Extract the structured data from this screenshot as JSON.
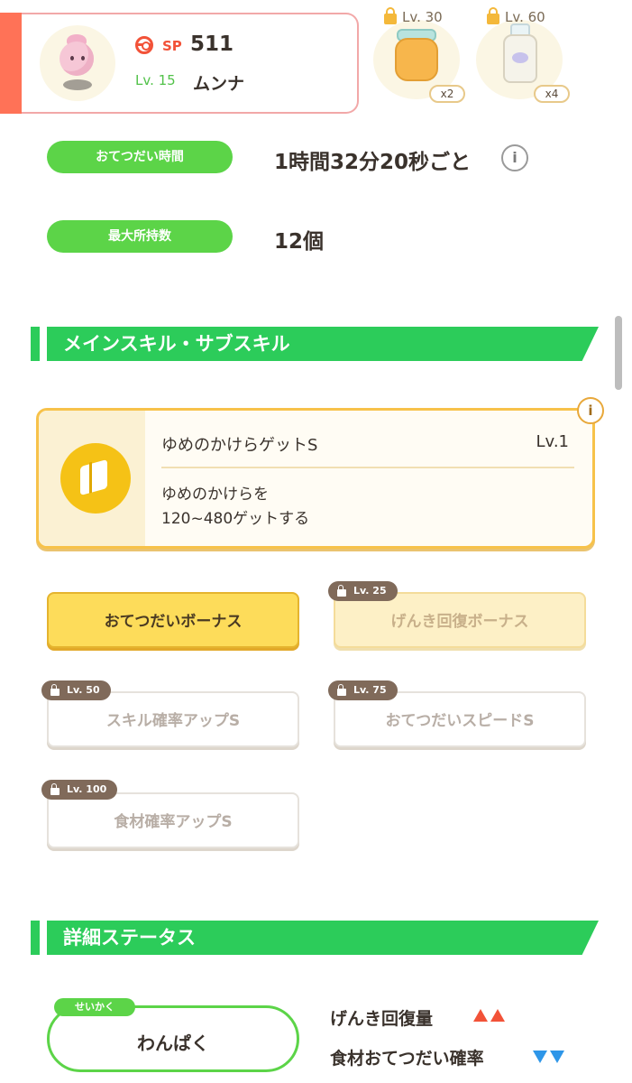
{
  "header": {
    "sp_label": "SP",
    "sp_value": "511",
    "level": "Lv. 15",
    "pokemon_name": "ムンナ",
    "items": [
      {
        "unlock_level": "Lv. 30",
        "count": "x2",
        "icon": "honey-jar-icon"
      },
      {
        "unlock_level": "Lv. 60",
        "count": "x4",
        "icon": "milk-bottle-icon"
      }
    ]
  },
  "stats": {
    "help_time_label": "おてつだい時間",
    "help_time_value": "1時間32分20秒ごと",
    "max_carry_label": "最大所持数",
    "max_carry_value": "12個"
  },
  "skills_section": {
    "title": "メインスキル・サブスキル",
    "main_skill": {
      "name": "ゆめのかけらゲットS",
      "level": "Lv.1",
      "desc_line1": "ゆめのかけらを",
      "desc_line2": "120~480ゲットする",
      "icon": "dream-shard-icon"
    },
    "sub_skills": [
      {
        "label": "おてつだいボーナス",
        "unlock": ""
      },
      {
        "label": "げんき回復ボーナス",
        "unlock": "Lv. 25"
      },
      {
        "label": "スキル確率アップS",
        "unlock": "Lv. 50"
      },
      {
        "label": "おてつだいスピードS",
        "unlock": "Lv. 75"
      },
      {
        "label": "食材確率アップS",
        "unlock": "Lv. 100"
      }
    ]
  },
  "details_section": {
    "title": "詳細ステータス",
    "nature_tag": "せいかく",
    "nature_value": "わんぱく",
    "effects": [
      {
        "label": "げんき回復量",
        "direction": "up",
        "count": 2
      },
      {
        "label": "食材おてつだい確率",
        "direction": "down",
        "count": 2
      }
    ]
  },
  "colors": {
    "accent_green": "#2ccc5a",
    "pill_green": "#5cd448",
    "sp_red": "#f25238",
    "down_blue": "#2e96e8",
    "skill_yellow": "#f5c216"
  }
}
